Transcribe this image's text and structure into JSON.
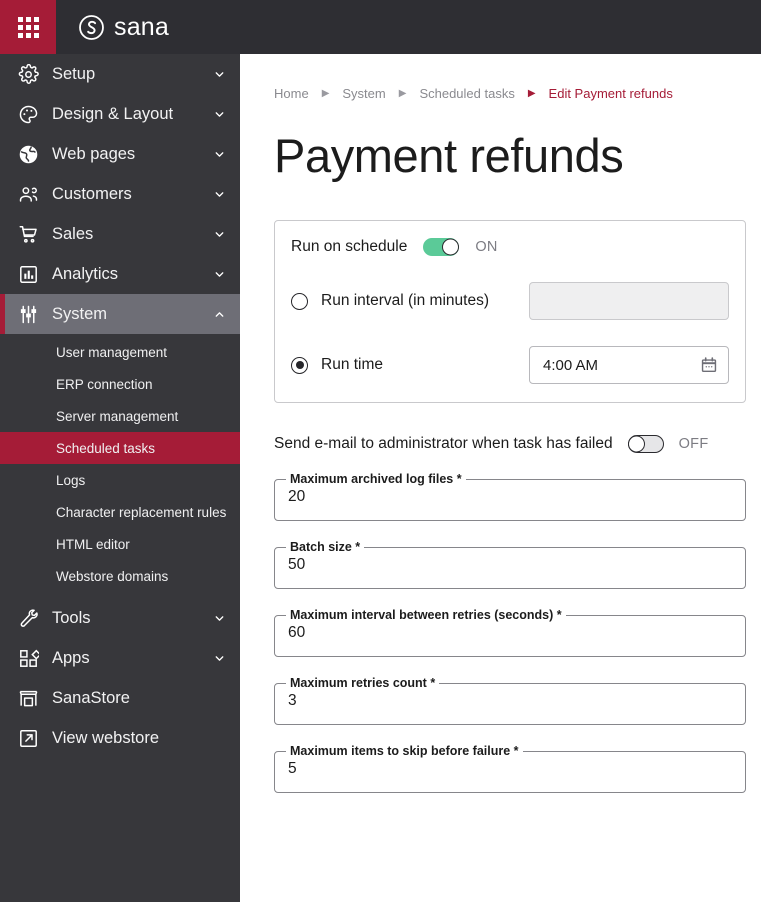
{
  "topbar": {
    "apps_icon": "grid-apps-icon",
    "brand_mark": "sana-circle-logo-icon",
    "brand_text": "sana",
    "bg_color": "#2E2E33",
    "accent_color": "#A51C37"
  },
  "sidebar": {
    "bg_color": "#37373B",
    "active_color": "#6E6E76",
    "accent_color": "#A51C37",
    "items": [
      {
        "label": "Setup",
        "icon": "gear-icon",
        "chevron": "chevron-down-icon",
        "expanded": false
      },
      {
        "label": "Design & Layout",
        "icon": "palette-icon",
        "chevron": "chevron-down-icon",
        "expanded": false
      },
      {
        "label": "Web pages",
        "icon": "globe-icon",
        "chevron": "chevron-down-icon",
        "expanded": false
      },
      {
        "label": "Customers",
        "icon": "people-icon",
        "chevron": "chevron-down-icon",
        "expanded": false
      },
      {
        "label": "Sales",
        "icon": "cart-icon",
        "chevron": "chevron-down-icon",
        "expanded": false
      },
      {
        "label": "Analytics",
        "icon": "bar-chart-icon",
        "chevron": "chevron-down-icon",
        "expanded": false
      },
      {
        "label": "System",
        "icon": "sliders-icon",
        "chevron": "chevron-up-icon",
        "expanded": true
      }
    ],
    "system_children": [
      {
        "label": "User management",
        "active": false
      },
      {
        "label": "ERP connection",
        "active": false
      },
      {
        "label": "Server management",
        "active": false
      },
      {
        "label": "Scheduled tasks",
        "active": true
      },
      {
        "label": "Logs",
        "active": false
      },
      {
        "label": "Character replacement rules",
        "active": false
      },
      {
        "label": "HTML editor",
        "active": false
      },
      {
        "label": "Webstore domains",
        "active": false
      }
    ],
    "bottom_items": [
      {
        "label": "Tools",
        "icon": "wrench-icon",
        "chevron": "chevron-down-icon"
      },
      {
        "label": "Apps",
        "icon": "apps-blocks-icon",
        "chevron": "chevron-down-icon"
      },
      {
        "label": "SanaStore",
        "icon": "store-icon",
        "chevron": ""
      },
      {
        "label": "View webstore",
        "icon": "external-link-icon",
        "chevron": ""
      }
    ]
  },
  "main": {
    "breadcrumb": [
      {
        "label": "Home",
        "current": false
      },
      {
        "label": "System",
        "current": false
      },
      {
        "label": "Scheduled tasks",
        "current": false
      },
      {
        "label": "Edit Payment refunds",
        "current": true
      }
    ],
    "breadcrumb_separator": "▶",
    "page_title": "Payment refunds",
    "schedule_card": {
      "run_on_schedule": {
        "label": "Run on schedule",
        "state_text": "ON",
        "checked": true
      },
      "options": [
        {
          "label": "Run interval (in minutes)",
          "selected": false,
          "input_value": "",
          "input_disabled": true,
          "icon": ""
        },
        {
          "label": "Run time",
          "selected": true,
          "input_value": "4:00 AM",
          "input_disabled": false,
          "icon": "calendar-icon"
        }
      ]
    },
    "email_toggle": {
      "label": "Send e-mail to administrator when task has failed",
      "state_text": "OFF",
      "checked": false
    },
    "fields": [
      {
        "label": "Maximum archived log files *",
        "value": "20"
      },
      {
        "label": "Batch size *",
        "value": "50"
      },
      {
        "label": "Maximum interval between retries (seconds) *",
        "value": "60"
      },
      {
        "label": "Maximum retries count *",
        "value": "3"
      },
      {
        "label": "Maximum items to skip before failure *",
        "value": "5"
      }
    ]
  }
}
